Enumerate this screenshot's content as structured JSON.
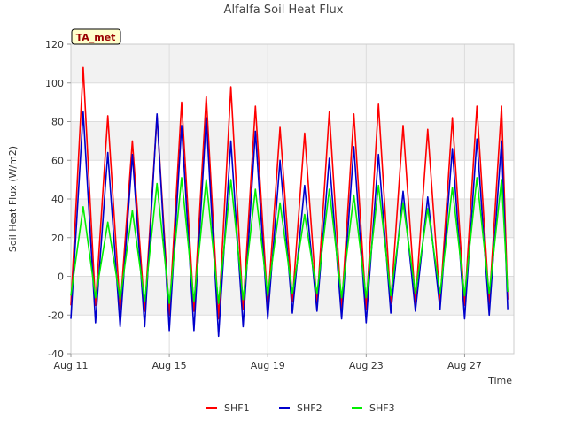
{
  "chart_data": {
    "type": "line",
    "title": "Alfalfa Soil Heat Flux",
    "xlabel": "Time",
    "ylabel": "Soil Heat Flux (W/m2)",
    "badge": "TA_met",
    "x_range": [
      "2024-08-11",
      "2024-08-29"
    ],
    "ylim": [
      -40,
      120
    ],
    "yticks": [
      -40,
      -20,
      0,
      20,
      40,
      60,
      80,
      100,
      120
    ],
    "xticks": [
      {
        "label": "Aug 11",
        "date": "2024-08-11"
      },
      {
        "label": "Aug 15",
        "date": "2024-08-15"
      },
      {
        "label": "Aug 19",
        "date": "2024-08-19"
      },
      {
        "label": "Aug 23",
        "date": "2024-08-23"
      },
      {
        "label": "Aug 27",
        "date": "2024-08-27"
      }
    ],
    "grid": true,
    "legend_position": "bottom-center",
    "series": [
      {
        "name": "SHF1",
        "color": "#ff0000",
        "x": [
          "2024-08-11 00:00",
          "2024-08-11 12:00",
          "2024-08-12 00:00",
          "2024-08-12 12:00",
          "2024-08-13 00:00",
          "2024-08-13 12:00",
          "2024-08-14 00:00",
          "2024-08-14 12:00",
          "2024-08-15 00:00",
          "2024-08-15 12:00",
          "2024-08-16 00:00",
          "2024-08-16 12:00",
          "2024-08-17 00:00",
          "2024-08-17 12:00",
          "2024-08-18 00:00",
          "2024-08-18 12:00",
          "2024-08-19 00:00",
          "2024-08-19 12:00",
          "2024-08-20 00:00",
          "2024-08-20 12:00",
          "2024-08-21 00:00",
          "2024-08-21 12:00",
          "2024-08-22 00:00",
          "2024-08-22 12:00",
          "2024-08-23 00:00",
          "2024-08-23 12:00",
          "2024-08-24 00:00",
          "2024-08-24 12:00",
          "2024-08-25 00:00",
          "2024-08-25 12:00",
          "2024-08-26 00:00",
          "2024-08-26 12:00",
          "2024-08-27 00:00",
          "2024-08-27 12:00",
          "2024-08-28 00:00",
          "2024-08-28 12:00",
          "2024-08-28 18:00"
        ],
        "y": [
          -15,
          108,
          -15,
          83,
          -17,
          70,
          -18,
          83,
          -20,
          90,
          -18,
          93,
          -22,
          98,
          -17,
          88,
          -15,
          77,
          -13,
          74,
          -15,
          85,
          -17,
          84,
          -17,
          89,
          -14,
          78,
          -14,
          76,
          -14,
          82,
          -15,
          88,
          -14,
          88,
          -12
        ]
      },
      {
        "name": "SHF2",
        "color": "#0000cc",
        "x": [
          "2024-08-11 00:00",
          "2024-08-11 12:00",
          "2024-08-12 00:00",
          "2024-08-12 12:00",
          "2024-08-13 00:00",
          "2024-08-13 12:00",
          "2024-08-14 00:00",
          "2024-08-14 12:00",
          "2024-08-15 00:00",
          "2024-08-15 12:00",
          "2024-08-16 00:00",
          "2024-08-16 12:00",
          "2024-08-17 00:00",
          "2024-08-17 12:00",
          "2024-08-18 00:00",
          "2024-08-18 12:00",
          "2024-08-19 00:00",
          "2024-08-19 12:00",
          "2024-08-20 00:00",
          "2024-08-20 12:00",
          "2024-08-21 00:00",
          "2024-08-21 12:00",
          "2024-08-22 00:00",
          "2024-08-22 12:00",
          "2024-08-23 00:00",
          "2024-08-23 12:00",
          "2024-08-24 00:00",
          "2024-08-24 12:00",
          "2024-08-25 00:00",
          "2024-08-25 12:00",
          "2024-08-26 00:00",
          "2024-08-26 12:00",
          "2024-08-27 00:00",
          "2024-08-27 12:00",
          "2024-08-28 00:00",
          "2024-08-28 12:00",
          "2024-08-28 18:00"
        ],
        "y": [
          -22,
          85,
          -24,
          64,
          -26,
          63,
          -26,
          84,
          -28,
          78,
          -28,
          82,
          -31,
          70,
          -26,
          75,
          -22,
          60,
          -19,
          47,
          -18,
          61,
          -22,
          67,
          -24,
          63,
          -19,
          44,
          -18,
          41,
          -17,
          66,
          -22,
          71,
          -20,
          70,
          -17
        ]
      },
      {
        "name": "SHF3",
        "color": "#00ee00",
        "x": [
          "2024-08-11 00:00",
          "2024-08-11 12:00",
          "2024-08-12 00:00",
          "2024-08-12 12:00",
          "2024-08-13 00:00",
          "2024-08-13 12:00",
          "2024-08-14 00:00",
          "2024-08-14 12:00",
          "2024-08-15 00:00",
          "2024-08-15 12:00",
          "2024-08-16 00:00",
          "2024-08-16 12:00",
          "2024-08-17 00:00",
          "2024-08-17 12:00",
          "2024-08-18 00:00",
          "2024-08-18 12:00",
          "2024-08-19 00:00",
          "2024-08-19 12:00",
          "2024-08-20 00:00",
          "2024-08-20 12:00",
          "2024-08-21 00:00",
          "2024-08-21 12:00",
          "2024-08-22 00:00",
          "2024-08-22 12:00",
          "2024-08-23 00:00",
          "2024-08-23 12:00",
          "2024-08-24 00:00",
          "2024-08-24 12:00",
          "2024-08-25 00:00",
          "2024-08-25 12:00",
          "2024-08-26 00:00",
          "2024-08-26 12:00",
          "2024-08-27 00:00",
          "2024-08-27 12:00",
          "2024-08-28 00:00",
          "2024-08-28 12:00",
          "2024-08-28 18:00"
        ],
        "y": [
          -10,
          36,
          -11,
          28,
          -12,
          34,
          -13,
          48,
          -14,
          51,
          -13,
          50,
          -14,
          50,
          -12,
          45,
          -10,
          38,
          -9,
          32,
          -9,
          45,
          -11,
          42,
          -11,
          47,
          -10,
          38,
          -9,
          35,
          -9,
          46,
          -10,
          51,
          -9,
          50,
          -8
        ]
      }
    ]
  }
}
